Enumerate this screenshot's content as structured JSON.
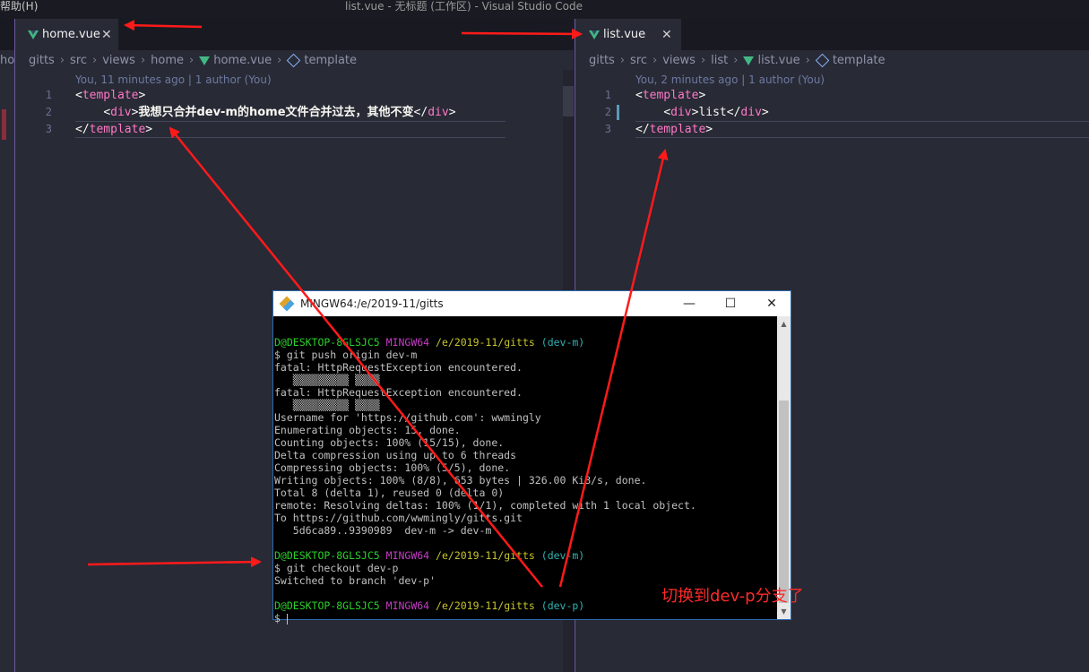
{
  "window": {
    "menu_fragment": "帮助(H)",
    "title": "list.vue - 无标题 (工作区) - Visual Studio Code"
  },
  "left_editor": {
    "tab_label": "home.vue",
    "close_glyph": "✕",
    "crumb_cut": "ho",
    "breadcrumb": [
      "gitts",
      "src",
      "views",
      "home",
      "home.vue",
      "template"
    ],
    "blame": "You, 11 minutes ago | 1 author (You)",
    "lines": [
      {
        "num": "1",
        "open": "<",
        "tag": "template",
        "close": ">"
      },
      {
        "num": "2",
        "indent": "    ",
        "open": "<",
        "tag": "div",
        "close": ">",
        "text": "我想只合并dev-m的home文件合并过去，其他不变",
        "open2": "</",
        "tag2": "div",
        "close2": ">"
      },
      {
        "num": "3",
        "open": "</",
        "tag": "template",
        "close": ">"
      }
    ]
  },
  "right_editor": {
    "tab_label": "list.vue",
    "close_glyph": "✕",
    "breadcrumb": [
      "gitts",
      "src",
      "views",
      "list",
      "list.vue",
      "template"
    ],
    "blame": "You, 2 minutes ago | 1 author (You)",
    "lines": [
      {
        "num": "1",
        "open": "<",
        "tag": "template",
        "close": ">"
      },
      {
        "num": "2",
        "indent": "    ",
        "open": "<",
        "tag": "div",
        "close": ">",
        "text": "list",
        "open2": "</",
        "tag2": "div",
        "close2": ">"
      },
      {
        "num": "3",
        "open": "</",
        "tag": "template",
        "close": ">"
      }
    ]
  },
  "terminal": {
    "title": "MINGW64:/e/2019-11/gitts",
    "minimize": "—",
    "maximize": "☐",
    "close": "✕",
    "prompt_user": "D@DESKTOP-8GLSJC5",
    "prompt_env": "MINGW64",
    "prompt_path": "/e/2019-11/gitts",
    "branch_m": "(dev-m)",
    "branch_p": "(dev-p)",
    "output1": [
      "$ git push origin dev-m",
      "fatal: HttpRequestException encountered.",
      "   ▒▒▒▒▒▒▒▒▒ ▒▒▒▒",
      "fatal: HttpRequestException encountered.",
      "   ▒▒▒▒▒▒▒▒▒ ▒▒▒▒",
      "Username for 'https://github.com': wwmingly",
      "Enumerating objects: 15, done.",
      "Counting objects: 100% (15/15), done.",
      "Delta compression using up to 6 threads",
      "Compressing objects: 100% (5/5), done.",
      "Writing objects: 100% (8/8), 653 bytes | 326.00 KiB/s, done.",
      "Total 8 (delta 1), reused 0 (delta 0)",
      "remote: Resolving deltas: 100% (1/1), completed with 1 local object.",
      "To https://github.com/wwmingly/gitts.git",
      "   5d6ca89..9390989  dev-m -> dev-m"
    ],
    "output2": [
      "$ git checkout dev-p",
      "Switched to branch 'dev-p'"
    ],
    "final_prompt": "$ "
  },
  "annotation": "切换到dev-p分支了",
  "colors": {
    "arrow": "#ff1a1a",
    "tag": "#ff79c6",
    "vue_green": "#41b883"
  }
}
